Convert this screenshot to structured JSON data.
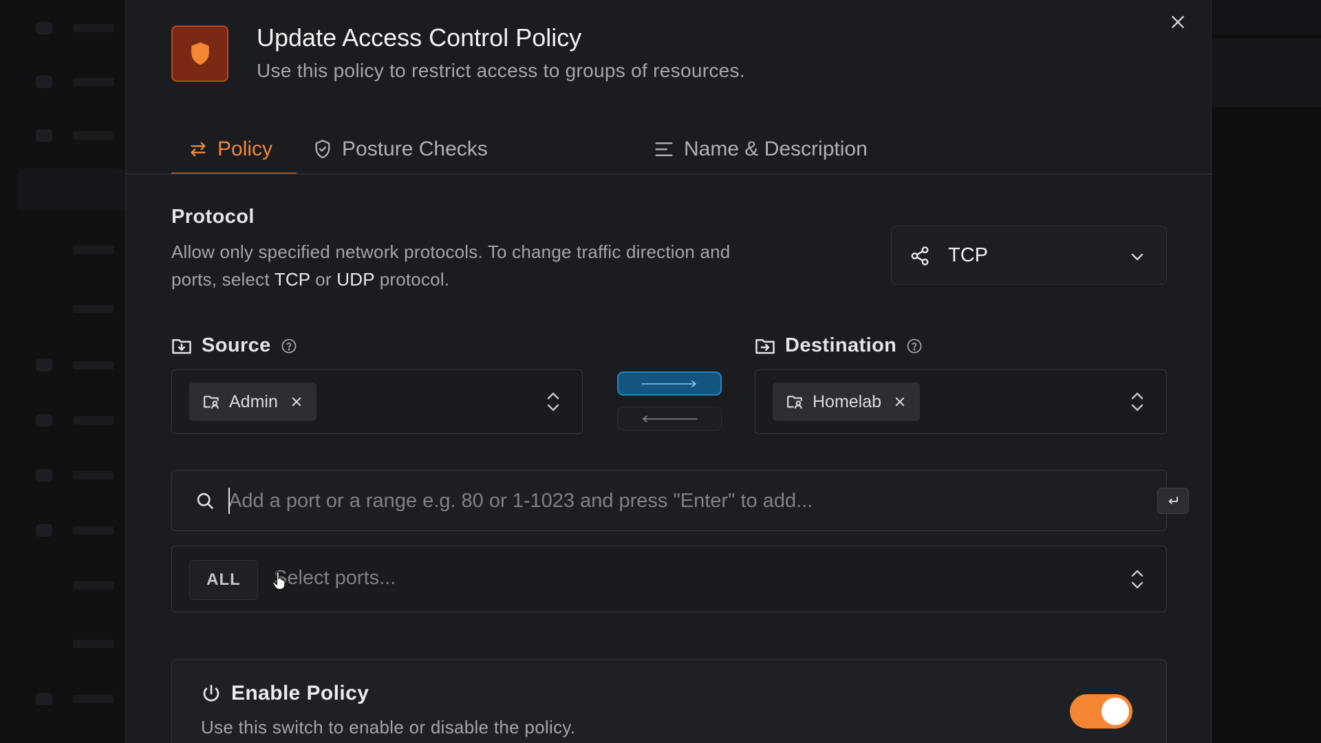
{
  "modal": {
    "title": "Update Access Control Policy",
    "subtitle": "Use this policy to restrict access to groups of resources."
  },
  "tabs": [
    {
      "label": "Policy",
      "icon": "arrows-exchange-icon",
      "active": true
    },
    {
      "label": "Posture Checks",
      "icon": "shield-check-icon",
      "active": false
    },
    {
      "label": "Name & Description",
      "icon": "text-lines-icon",
      "active": false
    }
  ],
  "protocol": {
    "label": "Protocol",
    "desc_part1": "Allow only specified network protocols. To change traffic direction and ports, select ",
    "desc_tcp": "TCP",
    "desc_or": " or ",
    "desc_udp": "UDP",
    "desc_end": " protocol.",
    "selected": "TCP"
  },
  "source": {
    "label": "Source",
    "groups": [
      "Admin"
    ]
  },
  "destination": {
    "label": "Destination",
    "groups": [
      "Homelab"
    ]
  },
  "ports": {
    "input_placeholder": "Add a port or a range e.g. 80 or 1-1023 and press \"Enter\" to add...",
    "badge": "ALL",
    "select_placeholder": "Select ports..."
  },
  "enable_policy": {
    "title": "Enable Policy",
    "desc": "Use this switch to enable or disable the policy.",
    "enabled": true
  },
  "colors": {
    "accent": "#f58634",
    "direction_active": "#1f87c2",
    "background": "#1b1c20"
  }
}
